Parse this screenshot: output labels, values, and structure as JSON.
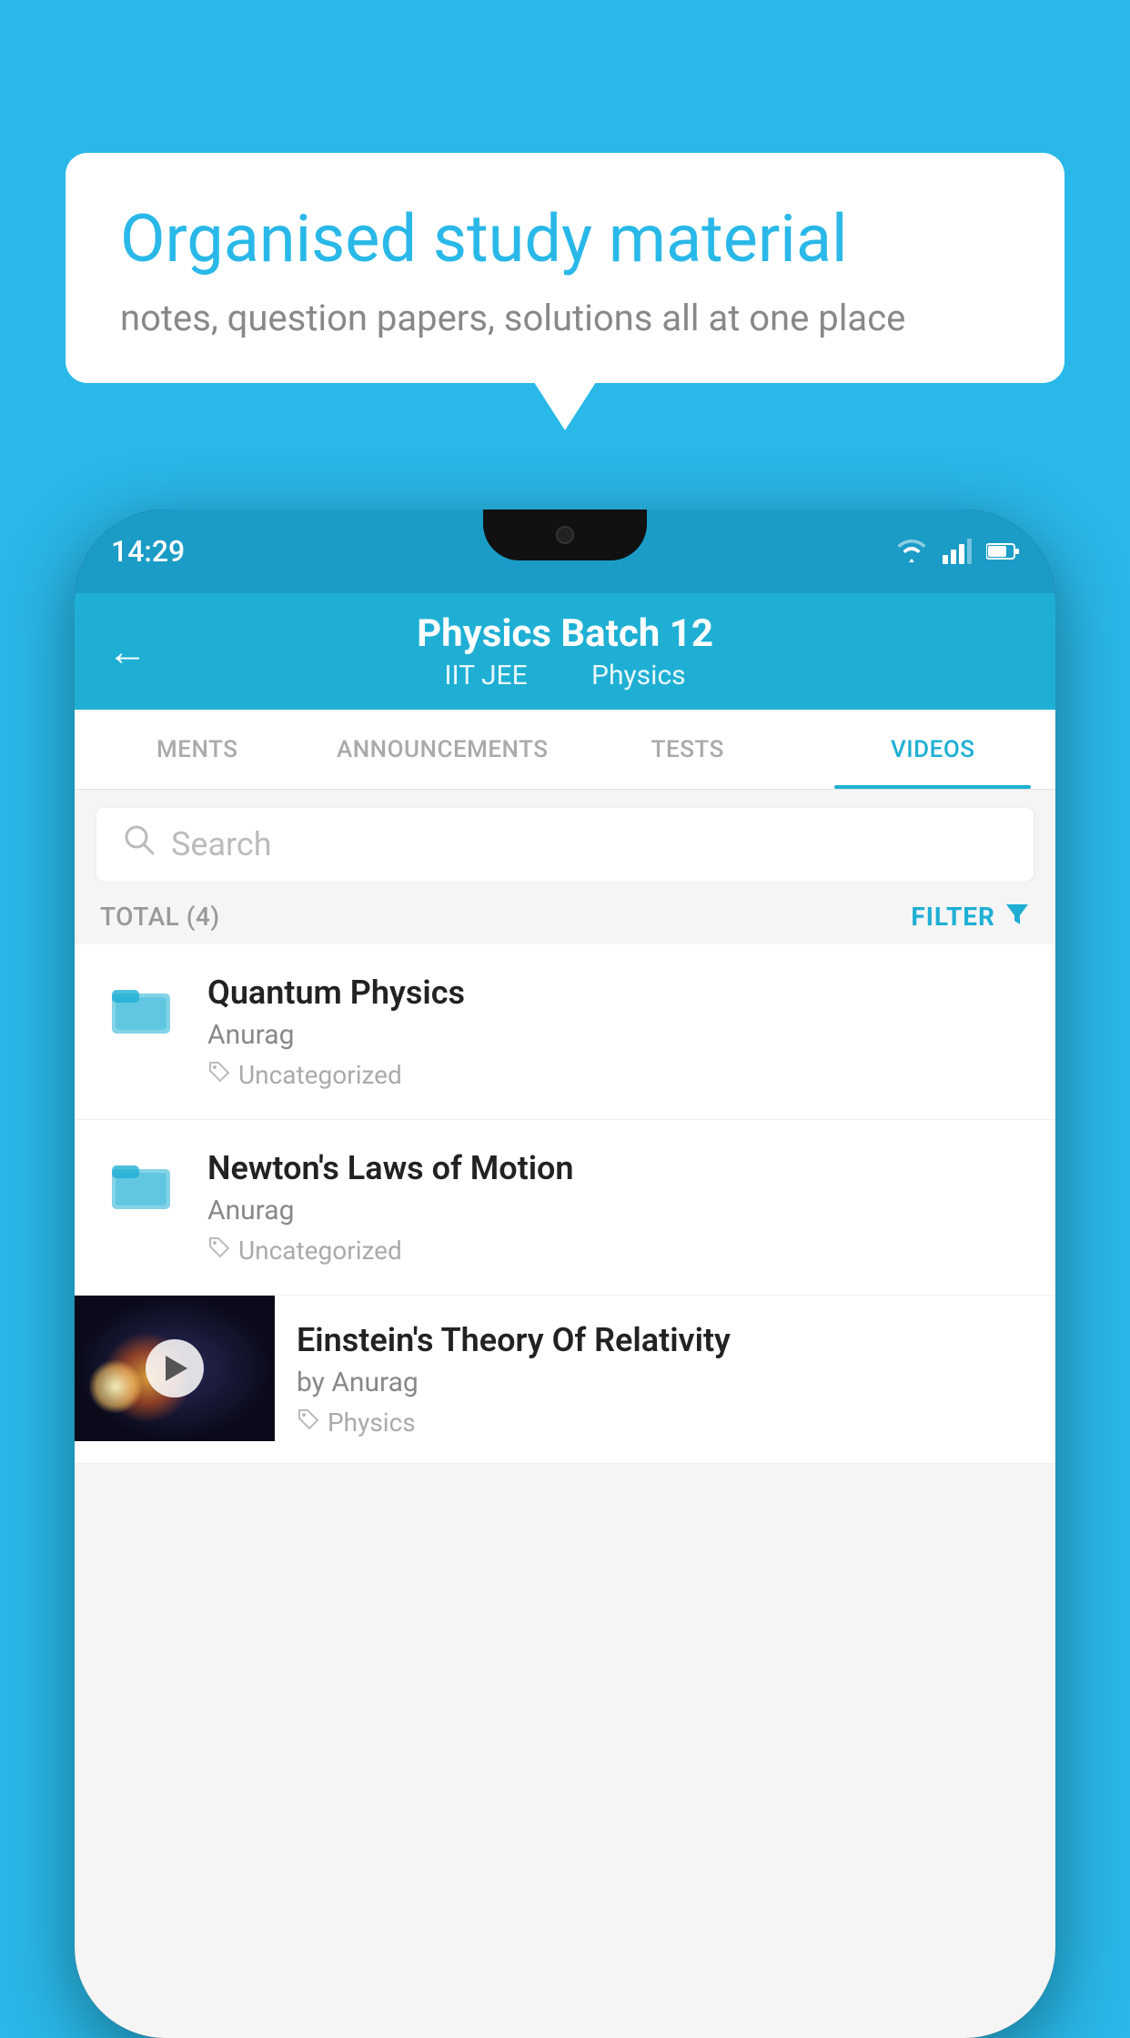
{
  "background_color": "#29b8e8",
  "speech_bubble": {
    "heading": "Organised study material",
    "subtext": "notes, question papers, solutions all at one place"
  },
  "phone": {
    "status_bar": {
      "time": "14:29",
      "wifi_icon": "wifi",
      "signal_icon": "signal",
      "battery_icon": "battery"
    },
    "app_header": {
      "back_label": "←",
      "title": "Physics Batch 12",
      "subtitle_part1": "IIT JEE",
      "subtitle_part2": "Physics"
    },
    "tabs": [
      {
        "label": "MENTS",
        "active": false
      },
      {
        "label": "ANNOUNCEMENTS",
        "active": false
      },
      {
        "label": "TESTS",
        "active": false
      },
      {
        "label": "VIDEOS",
        "active": true
      }
    ],
    "search": {
      "placeholder": "Search"
    },
    "filter_row": {
      "total_label": "TOTAL (4)",
      "filter_label": "FILTER"
    },
    "videos": [
      {
        "id": 1,
        "title": "Quantum Physics",
        "author": "Anurag",
        "tag": "Uncategorized",
        "type": "folder",
        "has_thumbnail": false
      },
      {
        "id": 2,
        "title": "Newton's Laws of Motion",
        "author": "Anurag",
        "tag": "Uncategorized",
        "type": "folder",
        "has_thumbnail": false
      },
      {
        "id": 3,
        "title": "Einstein's Theory Of Relativity",
        "author": "by Anurag",
        "tag": "Physics",
        "type": "video",
        "has_thumbnail": true
      }
    ]
  }
}
